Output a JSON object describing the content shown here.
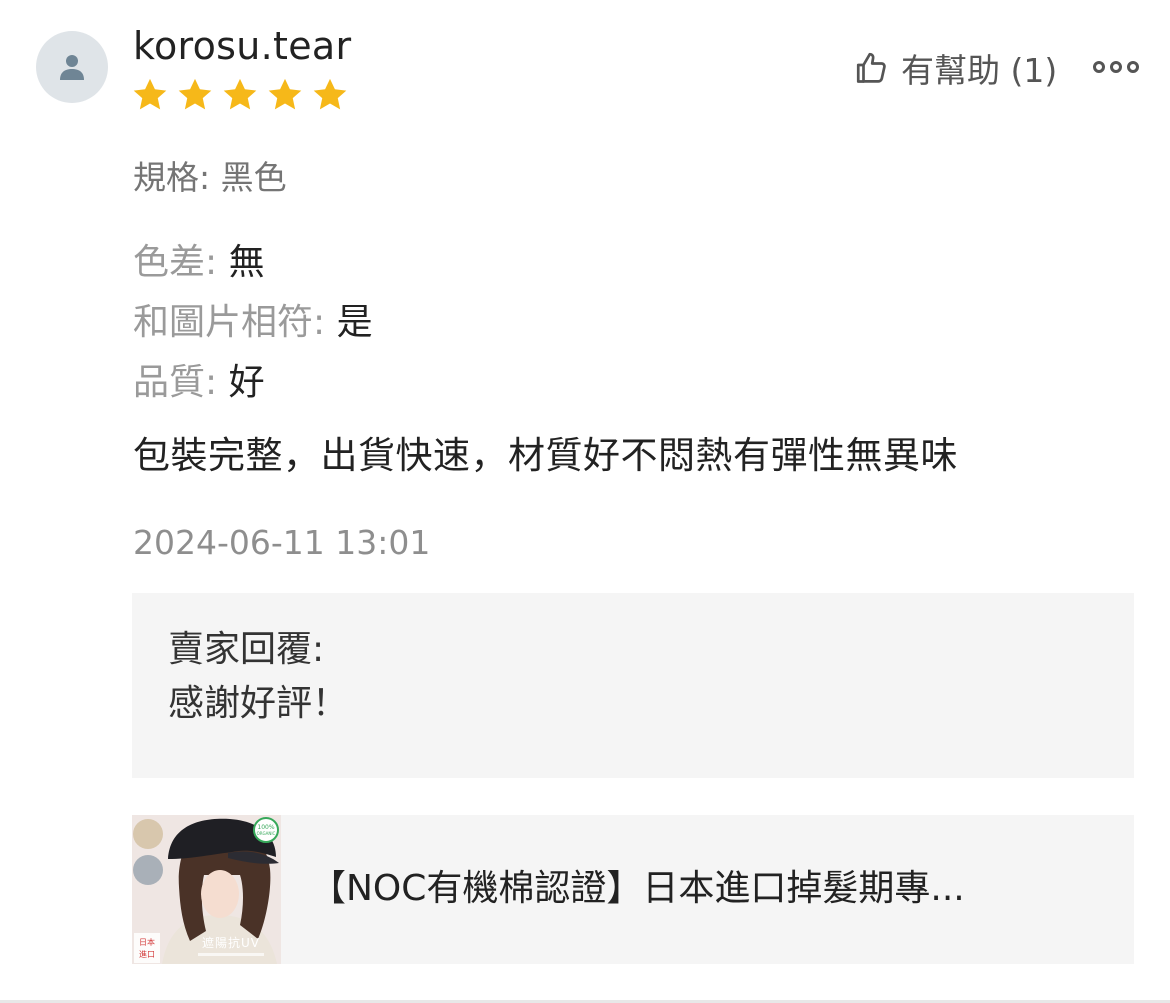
{
  "review": {
    "username": "korosu.tear",
    "rating": 5,
    "max_rating": 5,
    "helpful_label": "有幫助 (1)",
    "spec_label": "規格: 黑色",
    "attributes": [
      {
        "key": "色差: ",
        "value": "無"
      },
      {
        "key": "和圖片相符: ",
        "value": "是"
      },
      {
        "key": "品質: ",
        "value": "好"
      }
    ],
    "content": "包裝完整，出貨快速，材質好不悶熱有彈性無異味",
    "timestamp": "2024-06-11 13:01"
  },
  "seller_reply": {
    "title": "賣家回覆:",
    "text": "感謝好評！"
  },
  "product": {
    "name": "【NOC有機棉認證】日本進口掉髮期專...",
    "thumbnail_badge": "100%\nORGANIC",
    "thumbnail_tag_1": "日本",
    "thumbnail_tag_2": "進口",
    "thumbnail_caption": "遮陽抗UV"
  },
  "icons": {
    "avatar": "person-icon",
    "star": "star-icon",
    "helpful": "thumbs-up-icon",
    "more": "more-dots-icon"
  },
  "colors": {
    "star": "#f6b819",
    "avatar_bg": "#dfe4e8",
    "avatar_fg": "#6f8595",
    "panel_bg": "#f5f5f5"
  }
}
